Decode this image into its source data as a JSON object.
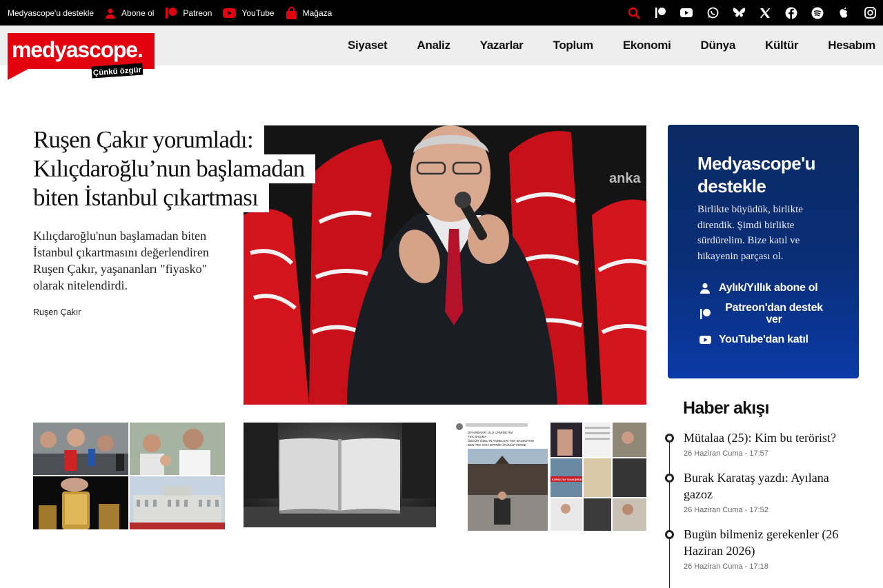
{
  "topbar": {
    "support_label": "Medyascope'u destekle",
    "links": [
      {
        "label": "Abone ol",
        "icon": "user-icon"
      },
      {
        "label": "Patreon",
        "icon": "patreon-icon"
      },
      {
        "label": "YouTube",
        "icon": "youtube-icon"
      },
      {
        "label": "Mağaza",
        "icon": "shopping-bag-icon"
      }
    ],
    "social_icons": [
      "search-icon",
      "patreon-icon",
      "youtube-icon",
      "whatsapp-icon",
      "bluesky-icon",
      "x-icon",
      "facebook-icon",
      "spotify-icon",
      "apple-icon",
      "instagram-icon"
    ],
    "accent_color": "#e3000f"
  },
  "logo": {
    "text": "medyascope.",
    "tagline": "Çünkü özgür",
    "color": "#e3000f"
  },
  "nav": {
    "items": [
      "Siyaset",
      "Analiz",
      "Yazarlar",
      "Toplum",
      "Ekonomi",
      "Dünya",
      "Kültür",
      "Hesabım"
    ]
  },
  "hero": {
    "title_lines": [
      "Ruşen Çakır yorumladı:",
      "Kılıçdaroğlu’nun başlamadan",
      "biten İstanbul çıkartması"
    ],
    "lead": "Kılıçdaroğlu'nun başlamadan biten İstanbul çıkartmasını değerlendiren Ruşen Çakır, yaşananları \"fiyasko\" olarak nitelendirdi.",
    "author": "Ruşen Çakır",
    "image_watermark": "anka"
  },
  "thumbs": {
    "third_tweet_lines": [
      "DİYARBAKIR ULU CAMİDEYİM",
      "TEK BAŞIMA",
      "ÖZGÜR ÖZEL'İN ANNELERİ TEK BAŞIMAYIM",
      "BEN TEK GİZ HEPİNİZ ÜTÜNÜZ YERSE"
    ],
    "third_banner": "KURULTAY SAVAŞINDA"
  },
  "support": {
    "title": "Medyascope'u destekle",
    "text": "Birlikte büyüdük, birlikte direndik. Şimdi birlikte sürdürelim. Bize katıl ve hikayenin parçası ol.",
    "links": [
      {
        "label": "Aylık/Yıllık abone ol",
        "icon": "user-icon"
      },
      {
        "label": "Patreon'dan destek ver",
        "icon": "patreon-icon"
      },
      {
        "label": "YouTube'dan katıl",
        "icon": "youtube-icon"
      }
    ]
  },
  "feed": {
    "title": "Haber akışı",
    "items": [
      {
        "title": "Mütalaa (25): Kim bu terörist?",
        "date": "26 Haziran Cuma",
        "time": "- 17:57"
      },
      {
        "title": "Burak Karataş yazdı: Ayılana gazoz",
        "date": "26 Haziran Cuma",
        "time": "- 17:52"
      },
      {
        "title": "Bugün bilmeniz gerekenler (26 Haziran 2026)",
        "date": "26 Haziran Cuma",
        "time": "- 17:18"
      }
    ]
  }
}
